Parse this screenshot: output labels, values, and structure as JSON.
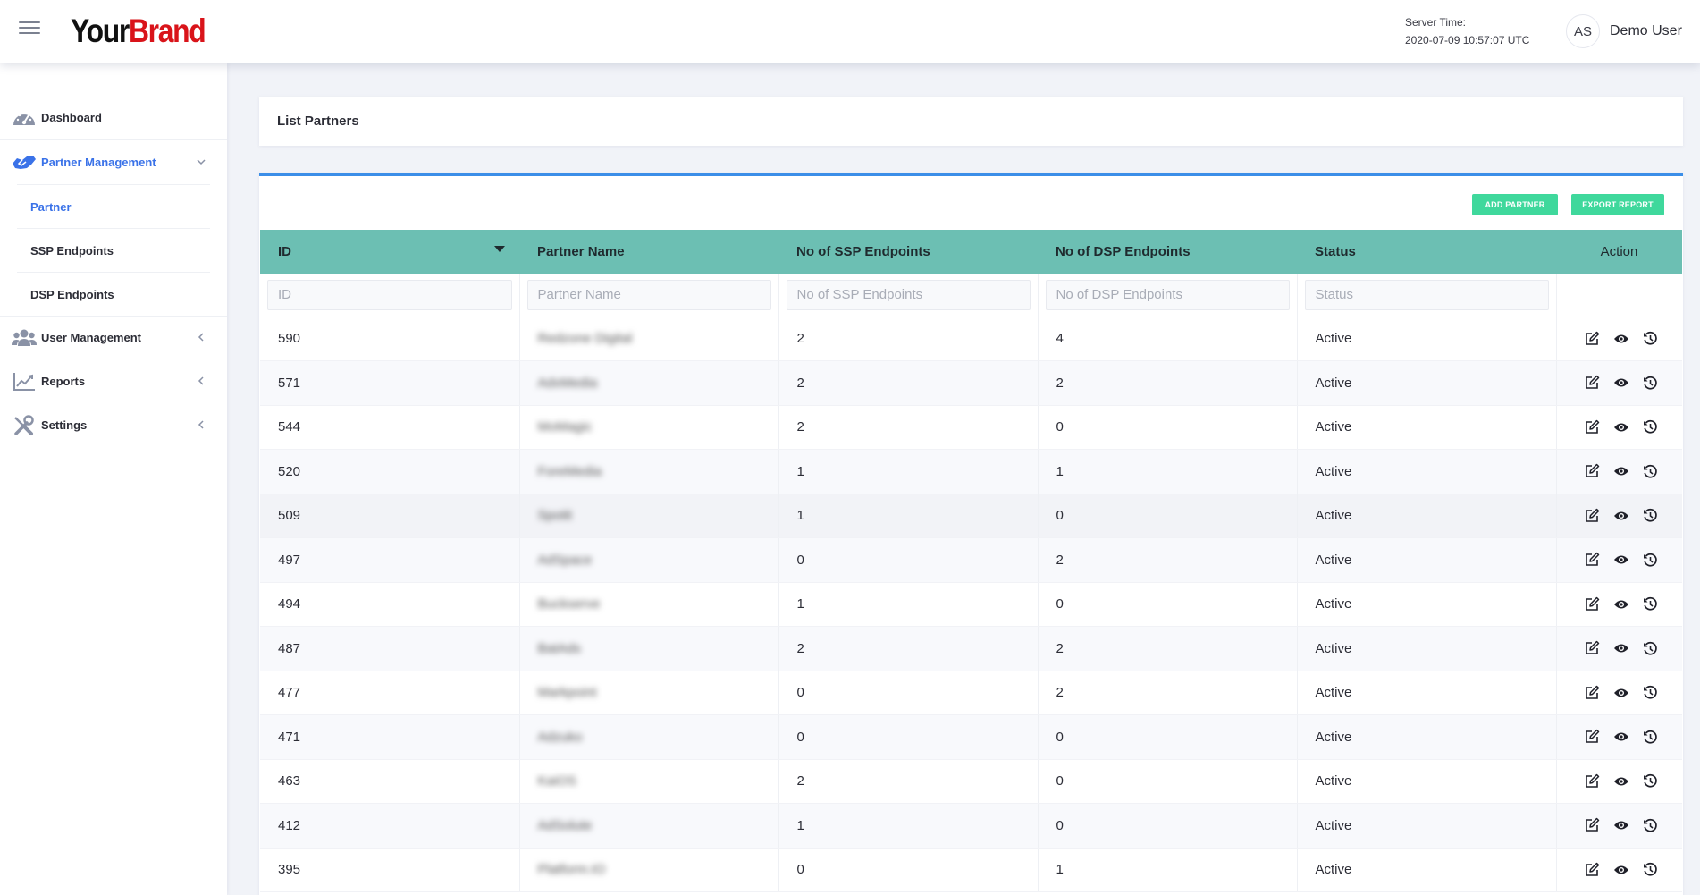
{
  "header": {
    "brand_part1": "Your",
    "brand_part2": "Brand",
    "server_time_label": "Server Time:",
    "server_time_value": "2020-07-09 10:57:07 UTC",
    "avatar_initials": "AS",
    "user_name": "Demo User"
  },
  "sidebar": {
    "items": [
      {
        "label": "Dashboard",
        "icon": "speedometer-icon"
      },
      {
        "label": "Partner Management",
        "icon": "handshake-icon"
      },
      {
        "label": "User Management",
        "icon": "users-icon"
      },
      {
        "label": "Reports",
        "icon": "chart-line-icon"
      },
      {
        "label": "Settings",
        "icon": "tools-icon"
      }
    ],
    "sub_items": [
      {
        "label": "Partner"
      },
      {
        "label": "SSP Endpoints"
      },
      {
        "label": "DSP Endpoints"
      }
    ]
  },
  "page": {
    "title": "List Partners",
    "add_partner_label": "ADD PARTNER",
    "export_report_label": "EXPORT REPORT"
  },
  "table": {
    "columns": [
      "ID",
      "Partner Name",
      "No of SSP Endpoints",
      "No of DSP Endpoints",
      "Status",
      "Action"
    ],
    "filter_placeholders": [
      "ID",
      "Partner Name",
      "No of SSP Endpoints",
      "No of DSP Endpoints",
      "Status"
    ],
    "rows": [
      {
        "id": "590",
        "name": "Redzone Digital",
        "ssp": "2",
        "dsp": "4",
        "status": "Active"
      },
      {
        "id": "571",
        "name": "AdxMedia",
        "ssp": "2",
        "dsp": "2",
        "status": "Active"
      },
      {
        "id": "544",
        "name": "MoMagic",
        "ssp": "2",
        "dsp": "0",
        "status": "Active"
      },
      {
        "id": "520",
        "name": "ForeMedia",
        "ssp": "1",
        "dsp": "1",
        "status": "Active"
      },
      {
        "id": "509",
        "name": "Spotit",
        "ssp": "1",
        "dsp": "0",
        "status": "Active"
      },
      {
        "id": "497",
        "name": "AdSpace",
        "ssp": "0",
        "dsp": "2",
        "status": "Active"
      },
      {
        "id": "494",
        "name": "Buckserve",
        "ssp": "1",
        "dsp": "0",
        "status": "Active"
      },
      {
        "id": "487",
        "name": "BatAds",
        "ssp": "2",
        "dsp": "2",
        "status": "Active"
      },
      {
        "id": "477",
        "name": "Markpoint",
        "ssp": "0",
        "dsp": "2",
        "status": "Active"
      },
      {
        "id": "471",
        "name": "Adzuko",
        "ssp": "0",
        "dsp": "0",
        "status": "Active"
      },
      {
        "id": "463",
        "name": "KaiOS",
        "ssp": "2",
        "dsp": "0",
        "status": "Active"
      },
      {
        "id": "412",
        "name": "AdSolute",
        "ssp": "1",
        "dsp": "0",
        "status": "Active"
      },
      {
        "id": "395",
        "name": "Platform.IO",
        "ssp": "0",
        "dsp": "1",
        "status": "Active"
      }
    ]
  },
  "colors": {
    "accent": "#3a72e8",
    "table_header": "#6cbfb3",
    "button": "#3fd89c",
    "brand_red": "#d9141a"
  }
}
